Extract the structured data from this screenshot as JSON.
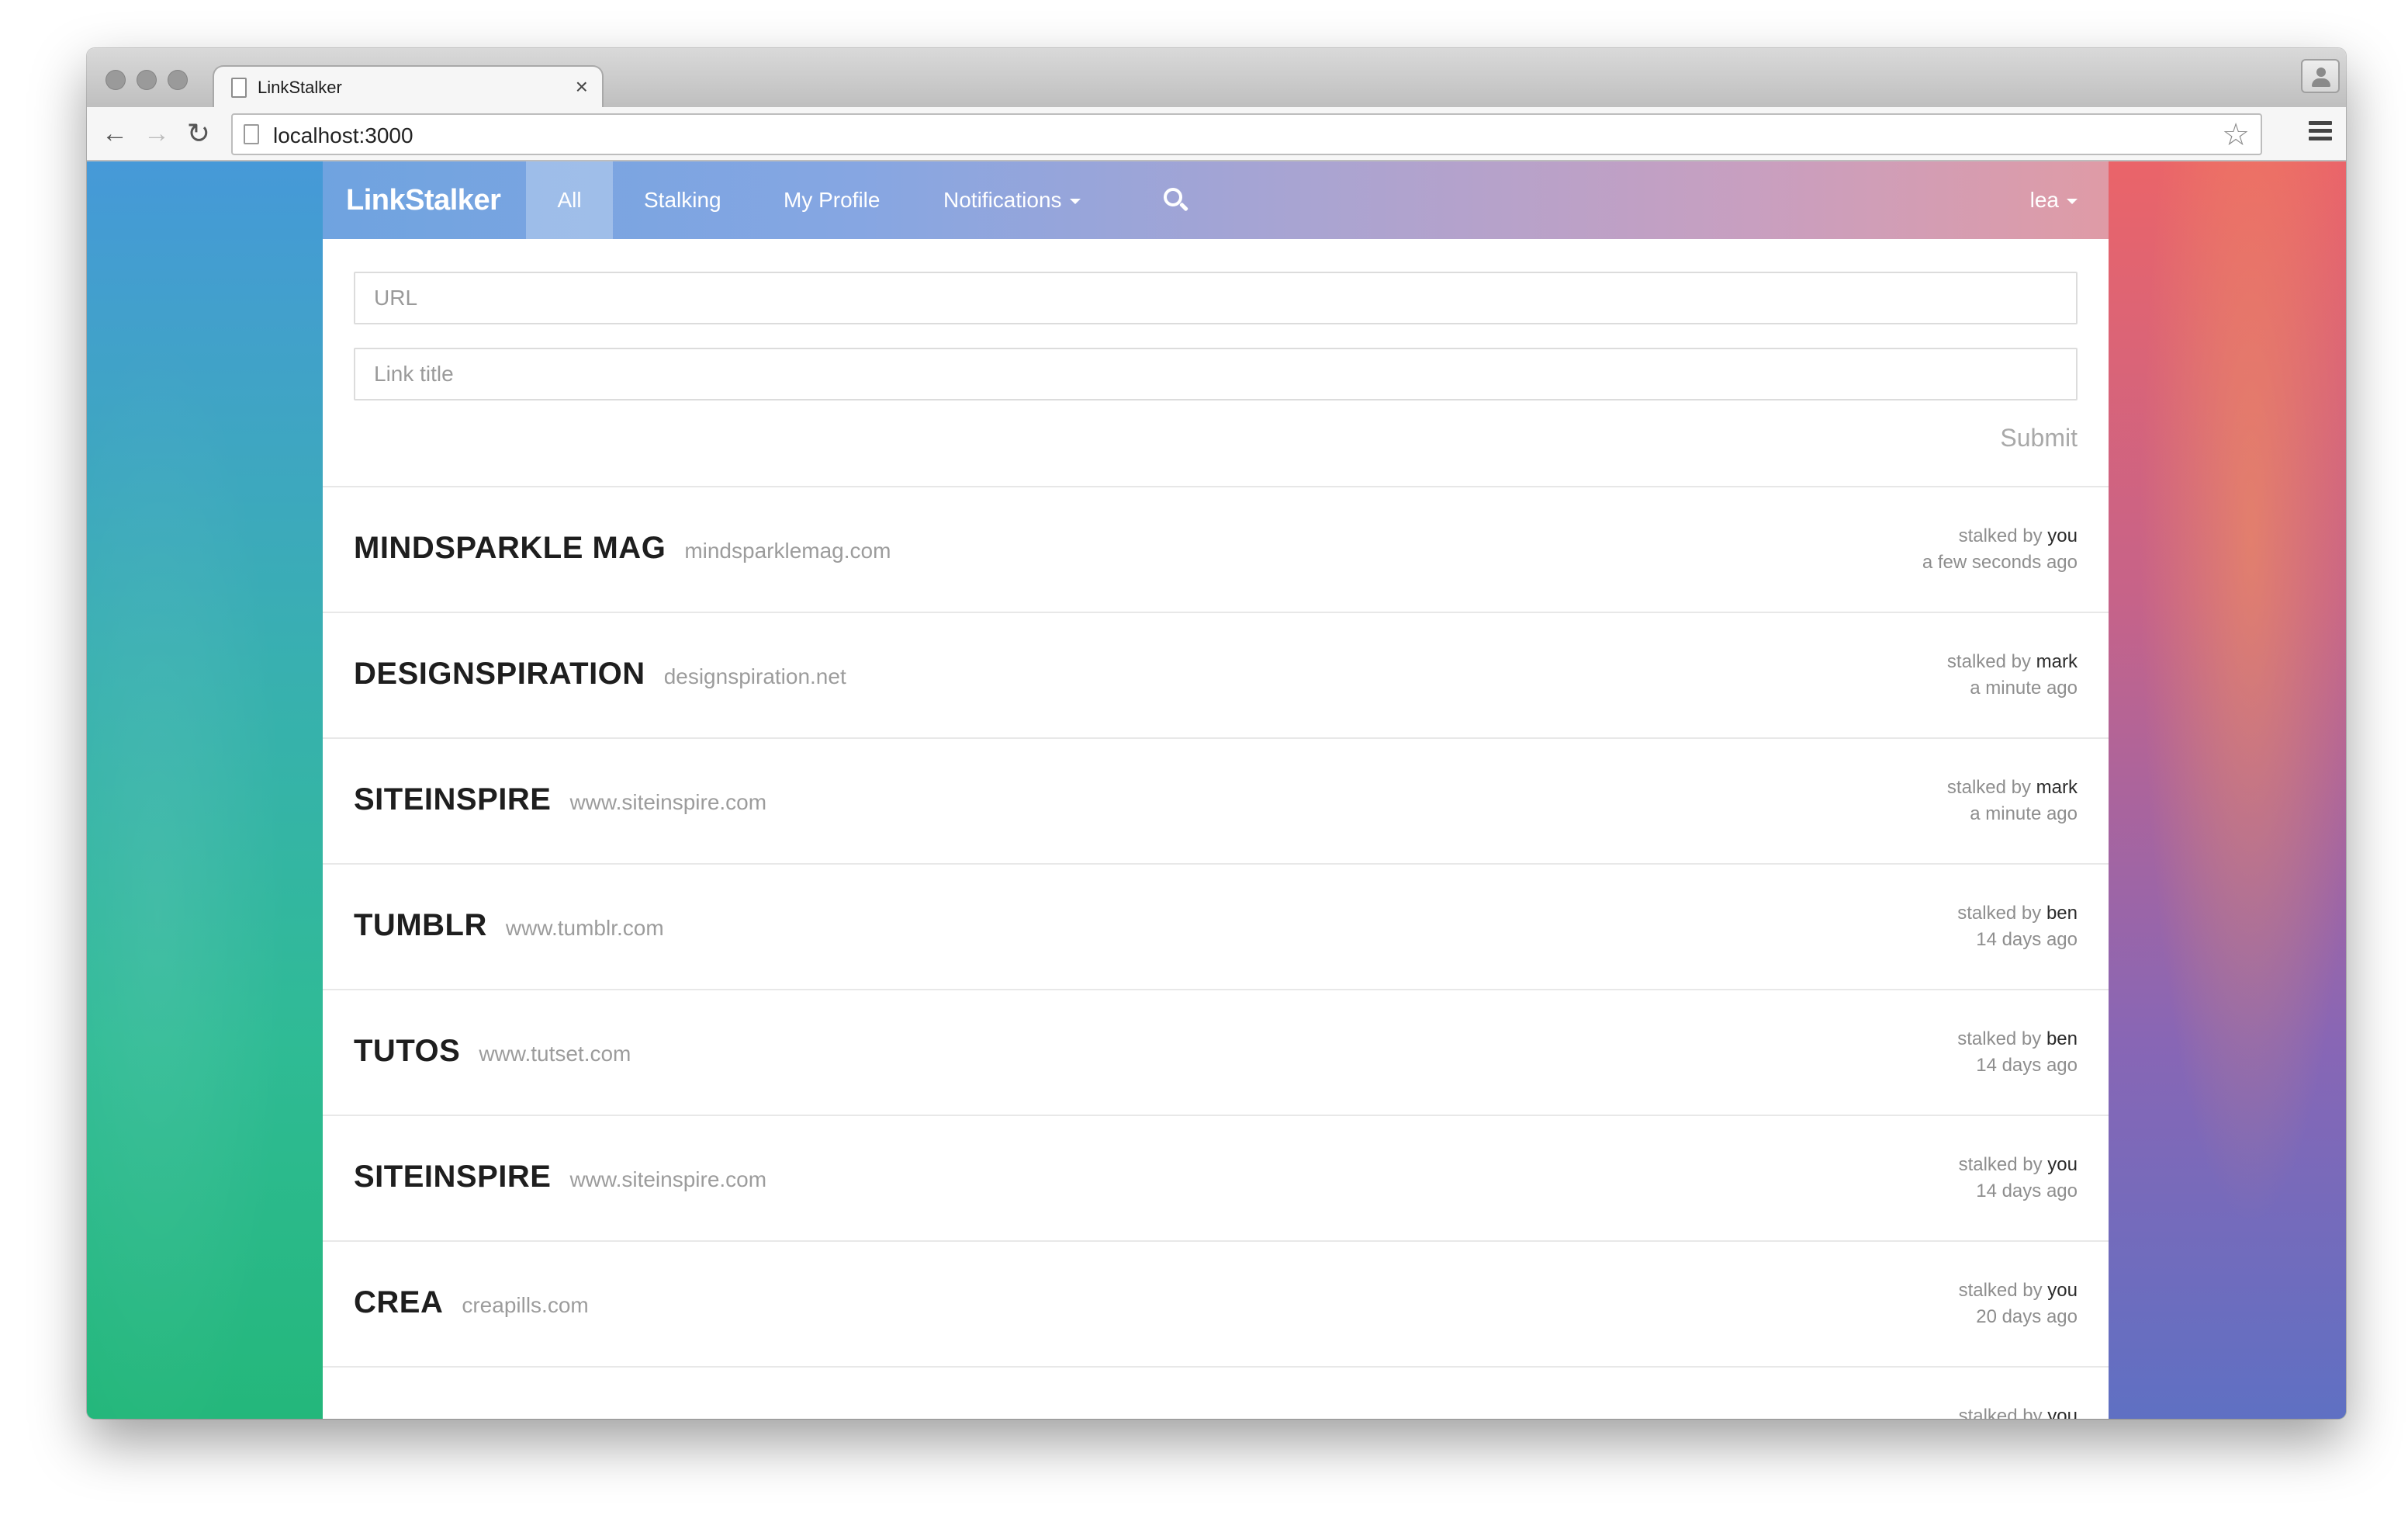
{
  "browser": {
    "tab_title": "LinkStalker",
    "tab_close": "×",
    "url": "localhost:3000",
    "icons": {
      "back": "arrow-left-icon",
      "forward": "arrow-right-icon",
      "reload": "reload-icon",
      "star": "star-icon",
      "menu": "hamburger-icon"
    }
  },
  "navbar": {
    "brand": "LinkStalker",
    "items": [
      {
        "label": "All",
        "active": true
      },
      {
        "label": "Stalking"
      },
      {
        "label": "My Profile"
      },
      {
        "label": "Notifications"
      }
    ],
    "user": "lea"
  },
  "form": {
    "url_placeholder": "URL",
    "title_placeholder": "Link title",
    "submit_label": "Submit"
  },
  "links": [
    {
      "title": "MINDSPARKLE MAG",
      "domain": "mindsparklemag.com",
      "stalked_by_label": "stalked by",
      "user": "you",
      "time": "a few seconds ago"
    },
    {
      "title": "DESIGNSPIRATION",
      "domain": "designspiration.net",
      "stalked_by_label": "stalked by",
      "user": "mark",
      "time": "a minute ago"
    },
    {
      "title": "SITEINSPIRE",
      "domain": "www.siteinspire.com",
      "stalked_by_label": "stalked by",
      "user": "mark",
      "time": "a minute ago"
    },
    {
      "title": "TUMBLR",
      "domain": "www.tumblr.com",
      "stalked_by_label": "stalked by",
      "user": "ben",
      "time": "14 days ago"
    },
    {
      "title": "TUTOS",
      "domain": "www.tutset.com",
      "stalked_by_label": "stalked by",
      "user": "ben",
      "time": "14 days ago"
    },
    {
      "title": "SITEINSPIRE",
      "domain": "www.siteinspire.com",
      "stalked_by_label": "stalked by",
      "user": "you",
      "time": "14 days ago"
    },
    {
      "title": "CREA",
      "domain": "creapills.com",
      "stalked_by_label": "stalked by",
      "user": "you",
      "time": "20 days ago"
    },
    {
      "title": "",
      "domain": "",
      "stalked_by_label": "stalked by",
      "user": "you",
      "time": ""
    }
  ],
  "colors": {
    "navbar_gradient_start": "#6fa3e0",
    "navbar_gradient_end": "#df9ba6",
    "bg_left": "#2fba90",
    "bg_right": "#c66389"
  }
}
